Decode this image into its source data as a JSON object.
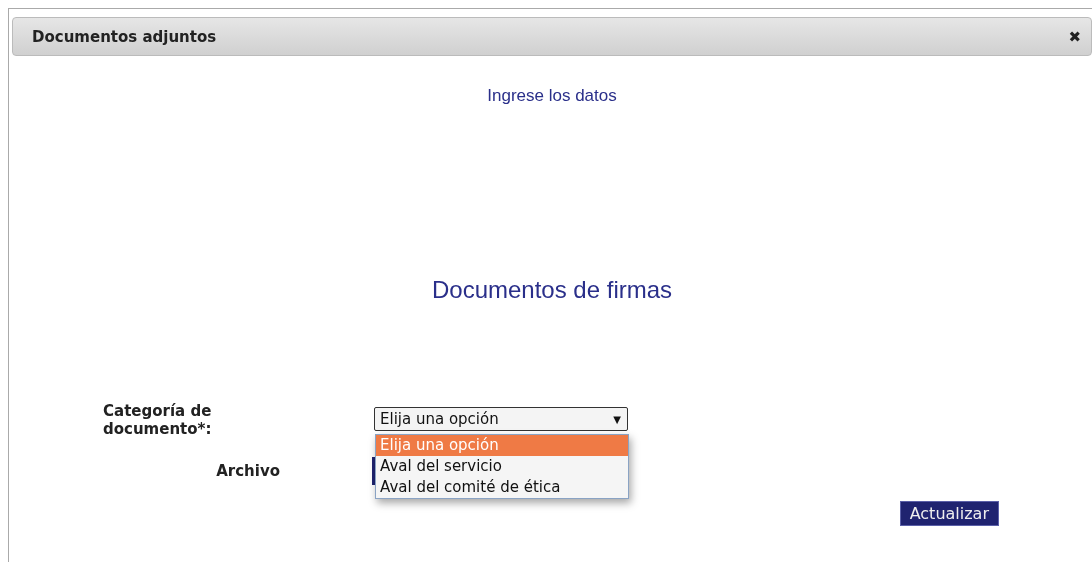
{
  "dialog": {
    "title": "Documentos adjuntos",
    "close": "✖"
  },
  "subtitle": "Ingrese los datos",
  "heading": "Documentos de firmas",
  "form": {
    "category_label": "Categoría de documento*:",
    "category_value": "Elija una opción",
    "dropdown_arrow": "▼",
    "options": [
      {
        "label": "Elija una opción",
        "selected": true
      },
      {
        "label": "Aval del servicio",
        "selected": false
      },
      {
        "label": "Aval del comité de ética",
        "selected": false
      }
    ],
    "file_label": "Archivo"
  },
  "submit": "Actualizar"
}
